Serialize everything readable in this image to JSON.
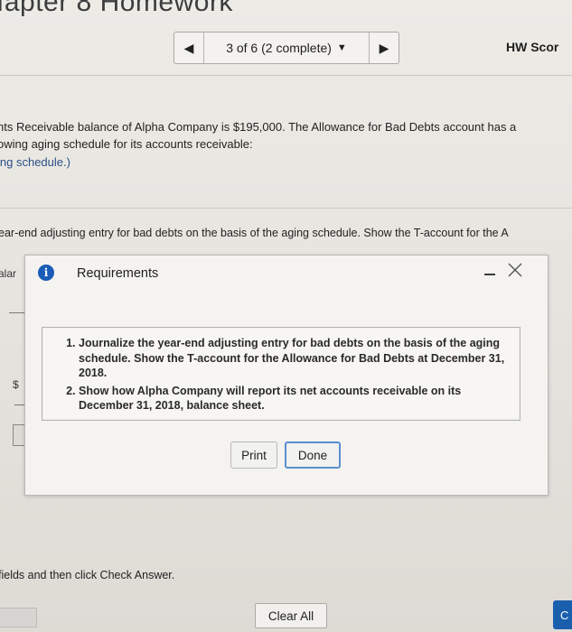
{
  "header": {
    "chapter_title": "Iapter 8 Homework",
    "nav_prev_icon": "triangle-left-icon",
    "nav_next_icon": "triangle-right-icon",
    "question_status": "3 of 6 (2 complete)",
    "hw_score_label": "HW Scor"
  },
  "problem": {
    "line1": "nts Receivable balance of Alpha Company is $195,000. The Allowance for Bad Debts account has a",
    "line2": "owing aging schedule for its accounts receivable:",
    "line3": "ing schedule.)"
  },
  "instruction": "ear-end adjusting entry for bad debts on the basis of the aging schedule. Show the T-account for the A",
  "left_fragments": {
    "balance_label": "alar",
    "dollar_sign": "$"
  },
  "dialog": {
    "icon": "info-icon",
    "title": "Requirements",
    "requirements": [
      "Journalize the year-end adjusting entry for bad debts on the basis of the aging schedule. Show the T-account for the Allowance for Bad Debts at December 31, 2018.",
      "Show how Alpha Company will report its net accounts receivable on its December 31, 2018, balance sheet."
    ],
    "print_label": "Print",
    "done_label": "Done"
  },
  "footer": {
    "instruction_text": "fields and then click Check Answer.",
    "clear_all_label": "Clear All",
    "check_answer_label": "C"
  },
  "colors": {
    "accent_blue": "#1a5fae",
    "info_icon_blue": "#1a5bb7",
    "done_border": "#5a8fd0"
  }
}
